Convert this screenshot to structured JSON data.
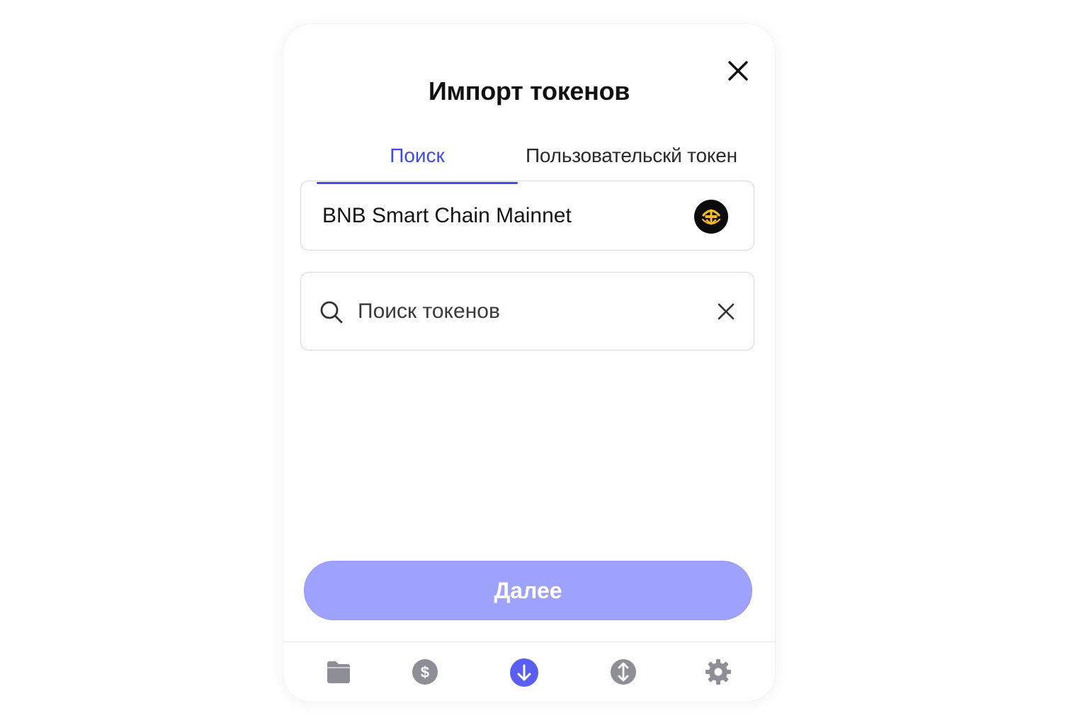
{
  "header": {
    "title": "Импорт токенов"
  },
  "tabs": [
    {
      "label": "Поиск",
      "active": true
    },
    {
      "label": "Пользовательскй токен",
      "active": false
    }
  ],
  "network": {
    "name": "BNB Smart Chain Mainnet",
    "icon": "bnb-logo-icon"
  },
  "search": {
    "value": "",
    "placeholder": "Поиск токенов"
  },
  "actions": {
    "next_label": "Далее"
  },
  "bottom_nav": [
    {
      "icon": "wallet-icon",
      "active": false
    },
    {
      "icon": "dollar-icon",
      "active": false
    },
    {
      "icon": "receive-arrow-icon",
      "active": true
    },
    {
      "icon": "swap-icon",
      "active": false
    },
    {
      "icon": "settings-gear-icon",
      "active": false
    }
  ],
  "colors": {
    "accent": "#3d4be8",
    "button_disabled": "#9fa2fc",
    "nav_active": "#5b5ff0",
    "nav_inactive": "#8e8e96",
    "border": "#d6d6dc"
  }
}
